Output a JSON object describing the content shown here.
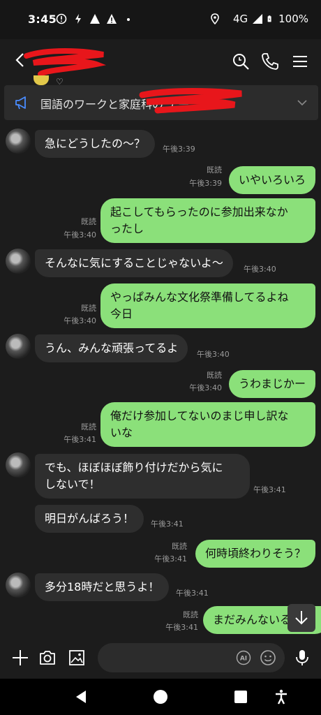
{
  "status": {
    "time": "3:45",
    "network": "4G",
    "battery": "100%"
  },
  "header": {
    "title": ""
  },
  "announcement": {
    "text": "国語のワークと家庭科の                    ナー..."
  },
  "messages": [
    {
      "side": "in",
      "text": "急にどうしたの〜？",
      "time": "午後3:39"
    },
    {
      "side": "out",
      "text": "いやいろいろ",
      "read": "既読",
      "time": "午後3:39"
    },
    {
      "side": "out",
      "text": "起こしてもらったのに参加出来なかったし",
      "line1": "起こしてもらったのに参加出来なか",
      "line2": "ったし",
      "read": "既読",
      "time": "午後3:40"
    },
    {
      "side": "in",
      "text": "そんなに気にすることじゃないよ〜",
      "time": "午後3:40"
    },
    {
      "side": "out",
      "text": "やっぱみんな文化祭準備してるよね今日",
      "line1": "やっぱみんな文化祭準備してるよね",
      "line2": "今日",
      "read": "既読",
      "time": "午後3:40"
    },
    {
      "side": "in",
      "text": "うん、みんな頑張ってるよ",
      "time": "午後3:40"
    },
    {
      "side": "out",
      "text": "うわまじかー",
      "read": "既読",
      "time": "午後3:40"
    },
    {
      "side": "out",
      "text": "俺だけ参加してないのまじ申し訳ないな",
      "line1": "俺だけ参加してないのまじ申し訳な",
      "line2": "いな",
      "read": "既読",
      "time": "午後3:41"
    },
    {
      "side": "in",
      "text": "でも、ほぼほぼ飾り付けだから気にしないで！",
      "line1": "でも、ほぼほぼ飾り付けだから気に",
      "line2": "しないで！",
      "time": "午後3:41"
    },
    {
      "side": "in",
      "text": "明日がんばろう！",
      "time": "午後3:41"
    },
    {
      "side": "out",
      "text": "何時頃終わりそう？",
      "read": "既読",
      "time": "午後3:41"
    },
    {
      "side": "in",
      "text": "多分18時だと思うよ！",
      "time": "午後3:41"
    },
    {
      "side": "out",
      "text": "まだみんないる？",
      "visible": "まだみんないる",
      "read": "既読",
      "time": "午後3:41"
    }
  ],
  "input": {
    "placeholder": ""
  },
  "icons": {
    "back": "chevron-left-icon",
    "search": "search-icon",
    "call": "phone-icon",
    "menu": "hamburger-icon",
    "announce": "megaphone-icon",
    "plus": "plus-icon",
    "camera": "camera-icon",
    "image": "image-icon",
    "ai": "ai-icon",
    "emoji": "emoji-icon",
    "mic": "mic-icon"
  },
  "colors": {
    "outgoing_bubble": "#8be07a",
    "incoming_bubble": "#2e2e2e",
    "background": "#1c1c1c",
    "redaction": "#e8161b"
  }
}
